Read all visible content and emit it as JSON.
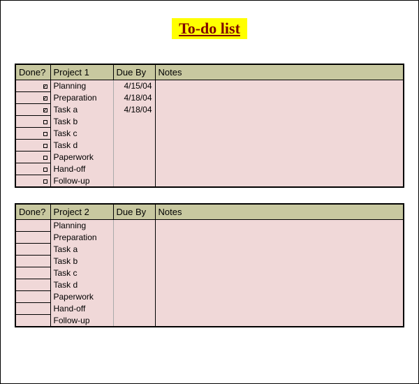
{
  "title": "To-do list",
  "tables": [
    {
      "headers": {
        "done": "Done?",
        "project": "Project 1",
        "due": "Due By",
        "notes": "Notes"
      },
      "rows": [
        {
          "checked": true,
          "task": "Planning",
          "due": "4/15/04",
          "notes": ""
        },
        {
          "checked": true,
          "task": "Preparation",
          "due": "4/18/04",
          "notes": ""
        },
        {
          "checked": true,
          "task": "Task a",
          "due": "4/18/04",
          "notes": ""
        },
        {
          "checked": false,
          "task": "Task b",
          "due": "",
          "notes": ""
        },
        {
          "checked": false,
          "task": "Task c",
          "due": "",
          "notes": ""
        },
        {
          "checked": false,
          "task": "Task d",
          "due": "",
          "notes": ""
        },
        {
          "checked": false,
          "task": "Paperwork",
          "due": "",
          "notes": ""
        },
        {
          "checked": false,
          "task": "Hand-off",
          "due": "",
          "notes": ""
        },
        {
          "checked": false,
          "task": "Follow-up",
          "due": "",
          "notes": ""
        }
      ]
    },
    {
      "headers": {
        "done": "Done?",
        "project": "Project 2",
        "due": "Due By",
        "notes": "Notes"
      },
      "rows": [
        {
          "checked": null,
          "task": "Planning",
          "due": "",
          "notes": ""
        },
        {
          "checked": null,
          "task": "Preparation",
          "due": "",
          "notes": ""
        },
        {
          "checked": null,
          "task": "Task a",
          "due": "",
          "notes": ""
        },
        {
          "checked": null,
          "task": "Task b",
          "due": "",
          "notes": ""
        },
        {
          "checked": null,
          "task": "Task c",
          "due": "",
          "notes": ""
        },
        {
          "checked": null,
          "task": "Task d",
          "due": "",
          "notes": ""
        },
        {
          "checked": null,
          "task": "Paperwork",
          "due": "",
          "notes": ""
        },
        {
          "checked": null,
          "task": "Hand-off",
          "due": "",
          "notes": ""
        },
        {
          "checked": null,
          "task": "Follow-up",
          "due": "",
          "notes": ""
        }
      ]
    }
  ]
}
